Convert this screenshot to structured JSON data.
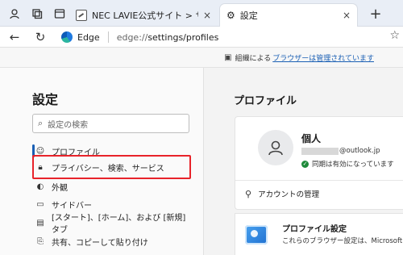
{
  "tabbar": {
    "inactive_tab": {
      "title": "NEC LAVIE公式サイト > サービス&サ",
      "close": "×"
    },
    "active_tab": {
      "title": "設定",
      "close": "×"
    },
    "new_tab": "+"
  },
  "navbar": {
    "browser_label": "Edge",
    "url_host": "edge://",
    "url_path": "settings/profiles"
  },
  "infobar": {
    "prefix": "組織による",
    "link": "ブラウザーは管理されています"
  },
  "sidebar": {
    "title": "設定",
    "search_placeholder": "設定の検索",
    "items": [
      {
        "label": "プロファイル",
        "icon": "profile-icon"
      },
      {
        "label": "プライバシー、検索、サービス",
        "icon": "lock-icon"
      },
      {
        "label": "外観",
        "icon": "palette-icon"
      },
      {
        "label": "サイドバー",
        "icon": "sidebar-icon"
      },
      {
        "label": "[スタート]、[ホーム]、および [新規] タブ",
        "icon": "home-tab-icon"
      },
      {
        "label": "共有、コピーして貼り付け",
        "icon": "share-icon"
      }
    ]
  },
  "main": {
    "title": "プロファイル",
    "profile": {
      "name": "個人",
      "email_suffix": "@outlook.jp",
      "sync_status": "同期は有効になっています",
      "manage_accounts": "アカウントの管理"
    },
    "profile_settings": {
      "title": "プロファイル設定",
      "description": "これらのブラウザー設定は、Microsoft Edge"
    }
  },
  "colors": {
    "accent": "#1a5fb4",
    "highlight_box": "#e8232a",
    "sync_ok": "#1e8a3a"
  }
}
